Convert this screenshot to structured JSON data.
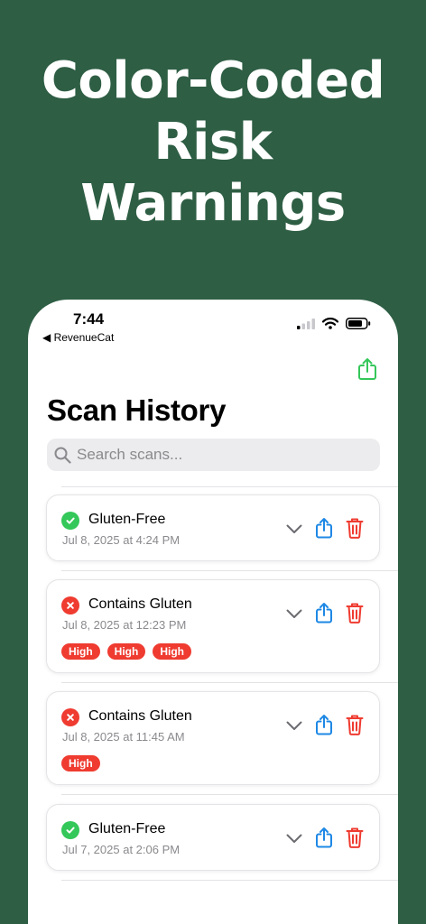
{
  "promo": {
    "headline_lines": [
      "Color-Coded",
      "Risk",
      "Warnings"
    ]
  },
  "status_bar": {
    "time": "7:44",
    "back_app": "◀ RevenueCat"
  },
  "page": {
    "title": "Scan History"
  },
  "search": {
    "placeholder": "Search scans...",
    "value": ""
  },
  "scans": [
    {
      "status": "pass",
      "title": "Gluten-Free",
      "date": "Jul 8, 2025 at 4:24 PM",
      "badges": []
    },
    {
      "status": "fail",
      "title": "Contains Gluten",
      "date": "Jul 8, 2025 at 12:23 PM",
      "badges": [
        "High",
        "High",
        "High"
      ]
    },
    {
      "status": "fail",
      "title": "Contains Gluten",
      "date": "Jul 8, 2025 at 11:45 AM",
      "badges": [
        "High"
      ]
    },
    {
      "status": "pass",
      "title": "Gluten-Free",
      "date": "Jul 7, 2025 at 2:06 PM",
      "badges": []
    }
  ],
  "colors": {
    "background": "#2e5e44",
    "pass": "#34c759",
    "fail": "#ef3b30",
    "share": "#1e88e5",
    "header_share": "#34c759"
  },
  "icons": {
    "search": "magnifier-icon",
    "expand": "chevron-down-icon",
    "share": "share-icon",
    "delete": "trash-icon",
    "pass": "checkmark-circle-icon",
    "fail": "x-circle-icon"
  }
}
